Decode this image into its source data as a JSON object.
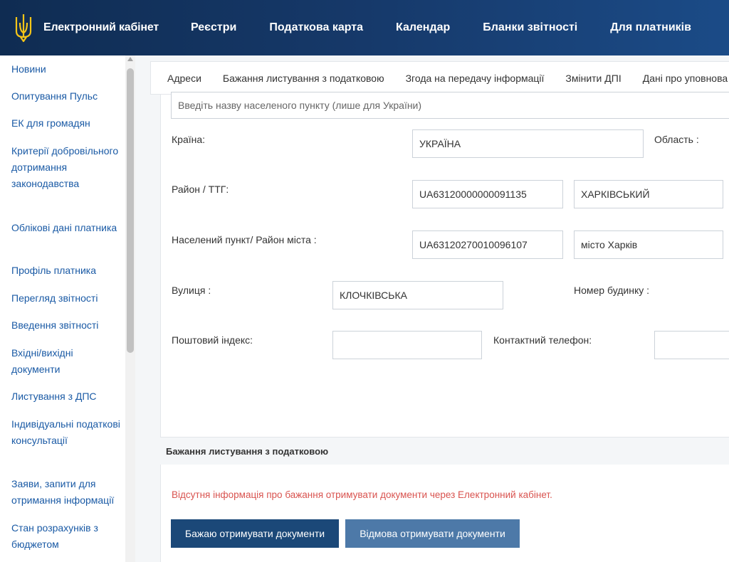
{
  "header": {
    "brand": "Електронний кабінет",
    "nav": [
      "Реєстри",
      "Податкова карта",
      "Календар",
      "Бланки звітності",
      "Для платників"
    ]
  },
  "sidebar": {
    "items": [
      "Новини",
      "Опитування Пульс",
      "ЕК для громадян",
      "Критерії добровільного дотримання законодавства",
      "Облікові дані платника",
      "Профіль платника",
      "Перегляд звітності",
      "Введення звітності",
      "Вхідні/вихідні документи",
      "Листування з ДПС",
      "Індивідуальні податкові консультації",
      "Заяви, запити для отримання інформації",
      "Стан розрахунків з бюджетом"
    ]
  },
  "tabs": [
    "Адреси",
    "Бажання листування з податковою",
    "Згода на передачу інформації",
    "Змінити ДПІ",
    "Дані про уповнова"
  ],
  "address": {
    "search_placeholder": "Введіть назву населеного пункту (лише для України)",
    "country_label": "Країна:",
    "country_value": "УКРАЇНА",
    "region_label": "Область :",
    "district_label": "Район / ТТГ:",
    "district_code": "UA63120000000091135",
    "district_name": "ХАРКІВСЬКИЙ",
    "locality_label": "Населений пункт/ Район міста :",
    "locality_code": "UA63120270010096107",
    "locality_name": "місто Харків",
    "street_label": "Вулиця :",
    "street_value": "КЛОЧКІВСЬКА",
    "house_label": "Номер будинку :",
    "postal_label": "Поштовий індекс:",
    "postal_value": "",
    "phone_label": "Контактний телефон:",
    "phone_value": ""
  },
  "correspondence": {
    "title": "Бажання листування з податковою",
    "warning": "Відсутня інформація про бажання отримувати документи через Електронний кабінет.",
    "accept_button": "Бажаю отримувати документи",
    "decline_button": "Відмова отримувати документи"
  },
  "colors": {
    "header_dark": "#0f2c52",
    "link": "#1a5aa5",
    "warning": "#d9534f",
    "primary_button": "#1b4878",
    "secondary_button": "#4d79a8",
    "trident": "#f5c518"
  },
  "icons": {
    "logo": "trident-icon"
  }
}
